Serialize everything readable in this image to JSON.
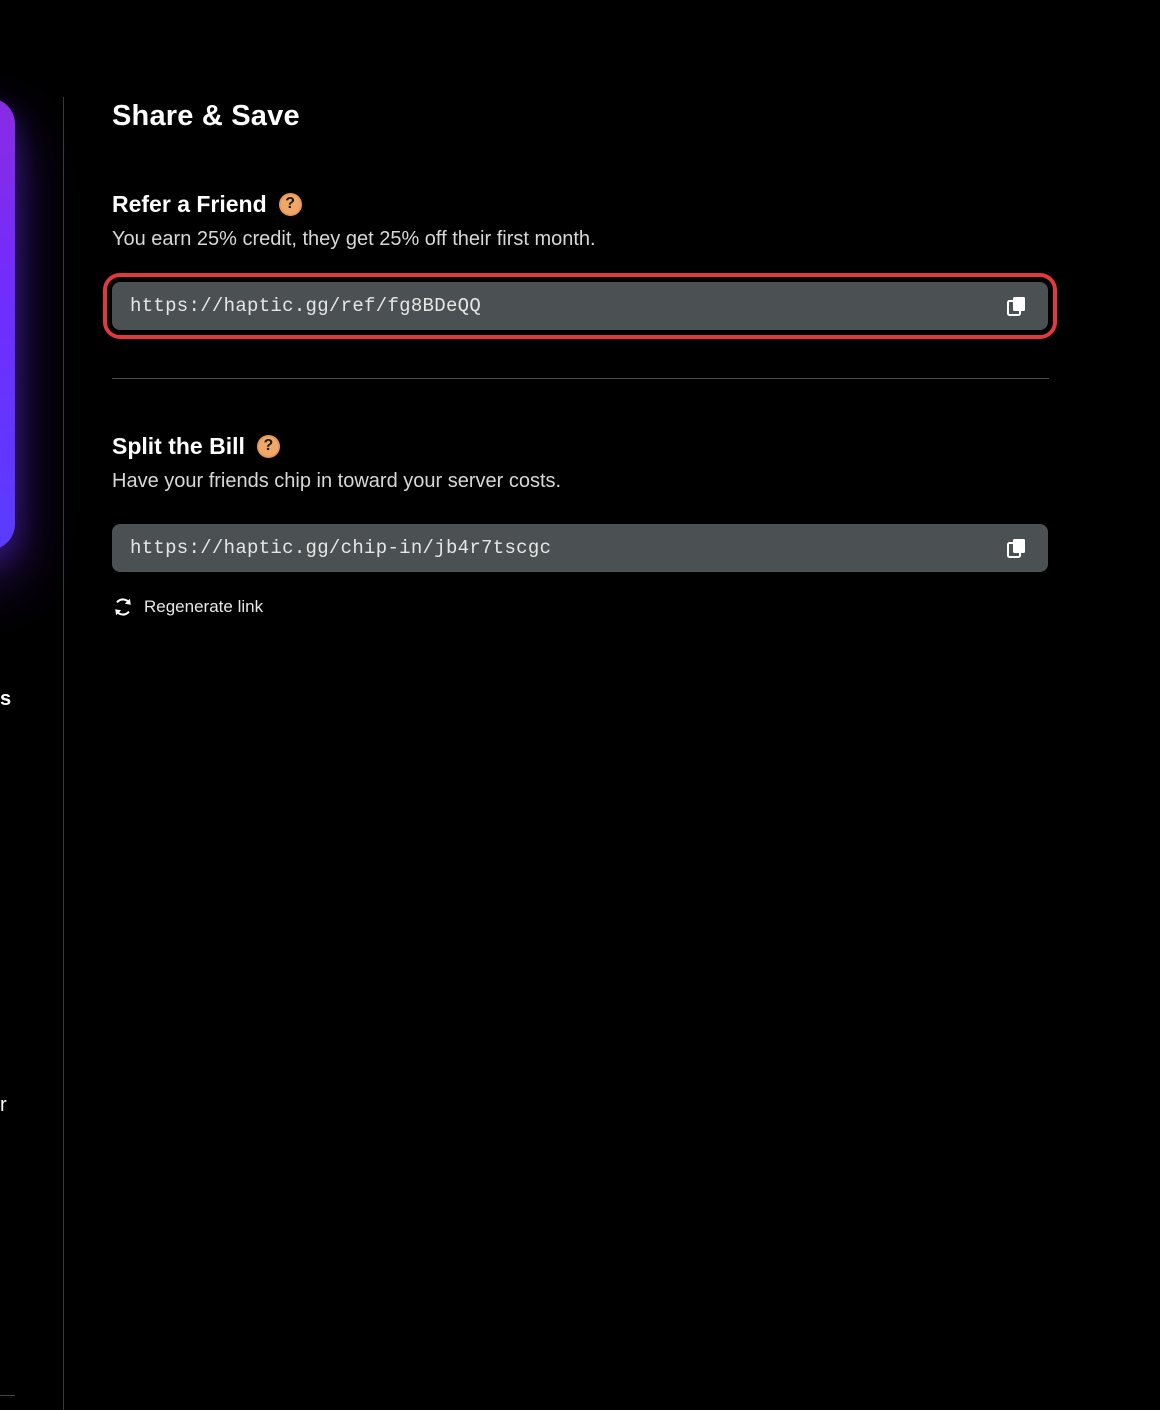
{
  "page": {
    "title": "Share & Save"
  },
  "refer": {
    "title": "Refer a Friend",
    "help_icon": "question-icon",
    "description": "You earn 25% credit, they get 25% off their first month.",
    "link": "https://haptic.gg/ref/fg8BDeQQ",
    "copy_icon": "copy-icon"
  },
  "split": {
    "title": "Split the Bill",
    "help_icon": "question-icon",
    "description": "Have your friends chip in toward your server costs.",
    "link": "https://haptic.gg/chip-in/jb4r7tscgc",
    "copy_icon": "copy-icon",
    "regenerate_label": "Regenerate link",
    "regenerate_icon": "refresh-icon"
  },
  "sidebar": {
    "fragment_1": "s",
    "fragment_2": "r"
  },
  "colors": {
    "background": "#000000",
    "field": "#4b5053",
    "help_icon": "#f0a868",
    "highlight": "#e0393f",
    "accent_gradient_top": "#8a2be2",
    "accent_gradient_bottom": "#5a3cff"
  }
}
